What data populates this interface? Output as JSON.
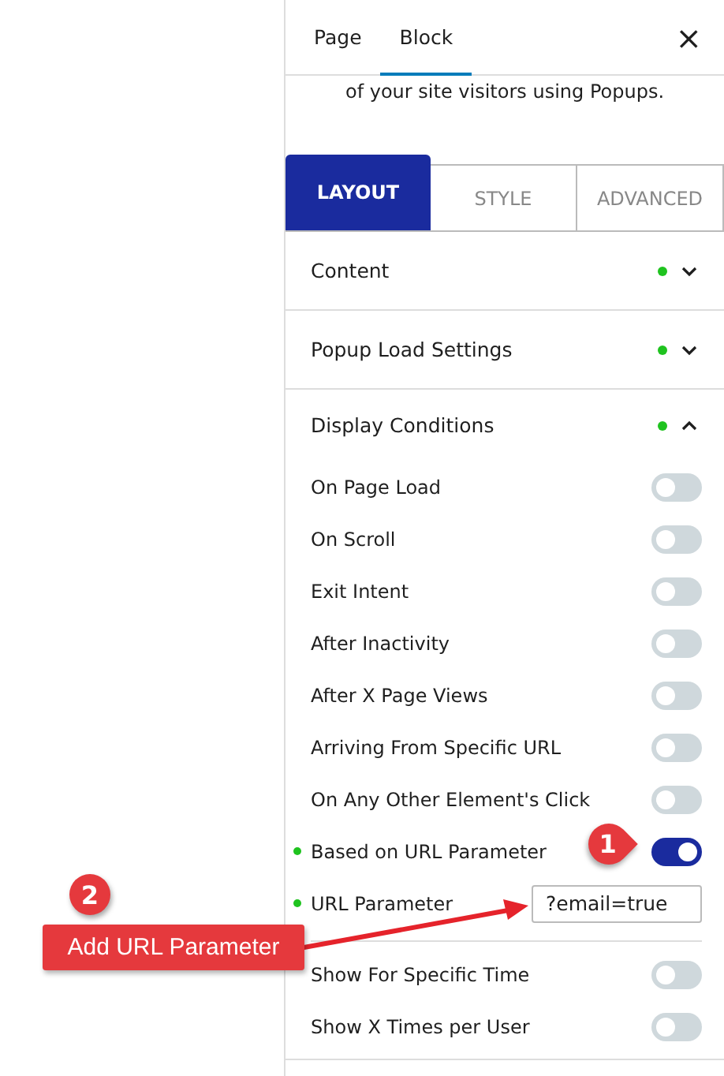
{
  "header_tabs": [
    {
      "label": "Page",
      "selected": false
    },
    {
      "label": "Block",
      "selected": true
    }
  ],
  "close_label": "×",
  "intro": "of your site visitors using Popups.",
  "settings_tabs": [
    {
      "label": "LAYOUT",
      "selected": true
    },
    {
      "label": "STYLE",
      "selected": false
    },
    {
      "label": "ADVANCED",
      "selected": false
    }
  ],
  "sections": [
    {
      "title": "Content",
      "expanded": false
    },
    {
      "title": "Popup Load Settings",
      "expanded": false
    },
    {
      "title": "Display Conditions",
      "expanded": true
    }
  ],
  "conditions": [
    {
      "kind": "toggle",
      "label": "On Page Load",
      "on": false,
      "active": false
    },
    {
      "kind": "toggle",
      "label": "On Scroll",
      "on": false,
      "active": false
    },
    {
      "kind": "toggle",
      "label": "Exit Intent",
      "on": false,
      "active": false
    },
    {
      "kind": "toggle",
      "label": "After Inactivity",
      "on": false,
      "active": false
    },
    {
      "kind": "toggle",
      "label": "After X Page Views",
      "on": false,
      "active": false
    },
    {
      "kind": "toggle",
      "label": "Arriving From Specific URL",
      "on": false,
      "active": false
    },
    {
      "kind": "toggle",
      "label": "On Any Other Element's Click",
      "on": false,
      "active": false
    },
    {
      "kind": "toggle",
      "label": "Based on URL Parameter",
      "on": true,
      "active": true
    },
    {
      "kind": "text",
      "label": "URL Parameter",
      "value": "?email=true",
      "active": true
    },
    {
      "kind": "divider"
    },
    {
      "kind": "toggle",
      "label": "Show For Specific Time",
      "on": false,
      "active": false
    },
    {
      "kind": "toggle",
      "label": "Show X Times per User",
      "on": false,
      "active": false
    }
  ],
  "annotations": {
    "badge_1": "1",
    "badge_2": "2",
    "callout": "Add URL Parameter"
  }
}
